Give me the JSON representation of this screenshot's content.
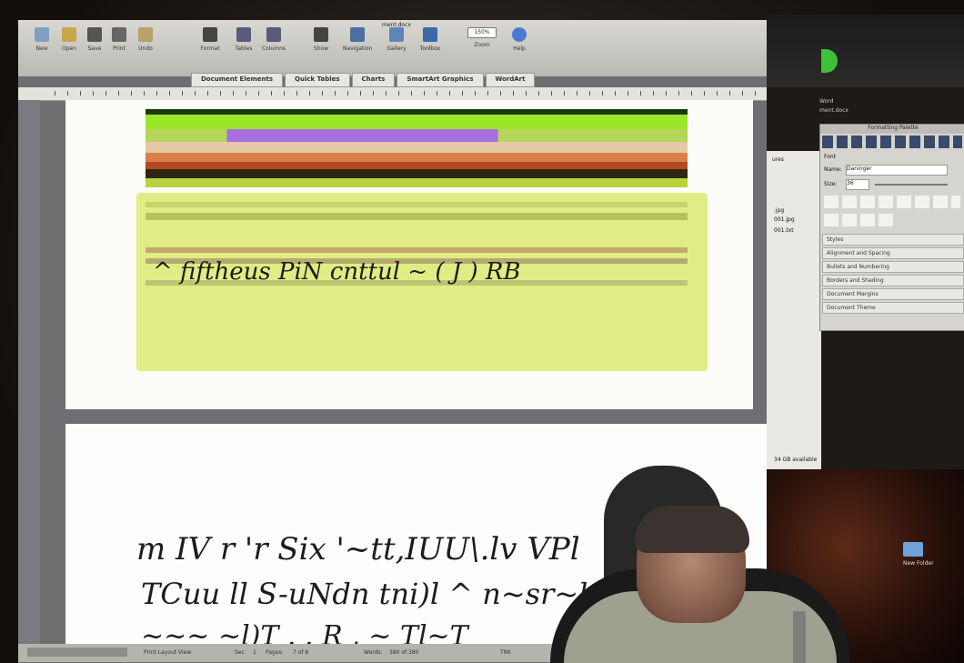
{
  "toolbar": {
    "items": [
      "New",
      "Open",
      "Save",
      "Print",
      "Undo",
      "Format",
      "Tables",
      "Columns",
      "Show",
      "Navigation",
      "Gallery",
      "Toolbox",
      "Zoom",
      "Help"
    ],
    "zoom_value": "150%",
    "window_title": "ment.docx"
  },
  "ribbon_tabs": [
    "Document Elements",
    "Quick Tables",
    "Charts",
    "SmartArt Graphics",
    "WordArt"
  ],
  "formatting_palette": {
    "title": "Formatting Palette",
    "section_font": "Font",
    "name_label": "Name:",
    "name_value": "Daninger",
    "size_label": "Size:",
    "size_value": "36",
    "sections": [
      "Styles",
      "Alignment and Spacing",
      "Bullets and Numbering",
      "Borders and Shading",
      "Document Margins",
      "Document Theme"
    ]
  },
  "right_labels": {
    "top": "Word",
    "top2": "ment.docx",
    "ures": "ures",
    "f1": ".jpg",
    "f2": "001.jpg",
    "f3": "001.txt",
    "available": "34 GB available",
    "new_folder": "New Folder"
  },
  "handwriting": {
    "line1": "^ fiftheus  PiN  cnttul ~ ( J  ) RB",
    "line2": "m IV r 'r Six '~tt,IUU\\.lv VPl",
    "line3": "TCuu ll S-uNdn tni)l ^ n~sr~l",
    "line4": "~~~ ~l)T . . R , ~ Tl~T"
  },
  "status_bar": {
    "view": "Print Layout View",
    "sec": "Sec",
    "sec_num": "1",
    "pages": "Pages:",
    "pages_val": "7 of 8",
    "words": "Words:",
    "words_val": "380 of 380",
    "percent": "TRK"
  }
}
